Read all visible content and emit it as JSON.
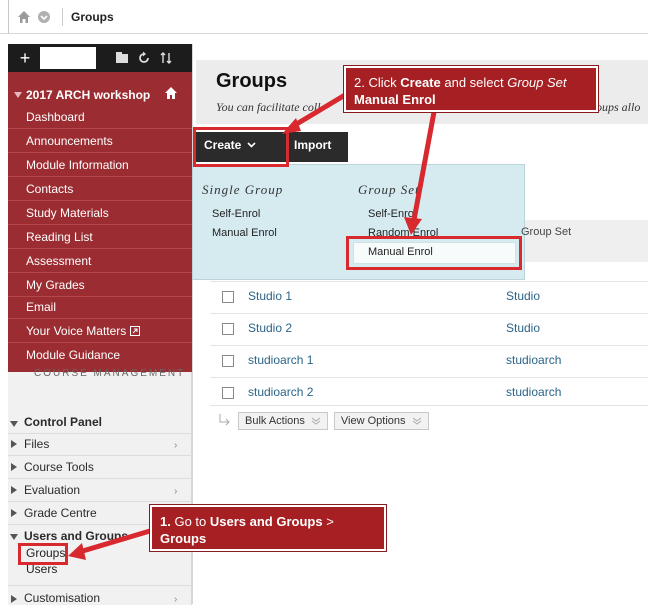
{
  "breadcrumb": {
    "current": "Groups"
  },
  "course": {
    "title": "2017 ARCH workshop",
    "menu": [
      "Dashboard",
      "Announcements",
      "Module Information",
      "Contacts",
      "Study Materials",
      "Reading List",
      "Assessment",
      "My Grades",
      "Email",
      "Your Voice Matters",
      "Module Guidance"
    ]
  },
  "management": {
    "heading": "COURSE MANAGEMENT",
    "control_panel": "Control Panel",
    "items": [
      "Files",
      "Course Tools",
      "Evaluation",
      "Grade Centre"
    ],
    "users_groups": "Users and Groups",
    "sub_items": [
      "Groups",
      "Users"
    ],
    "customisation": "Customisation"
  },
  "page": {
    "title": "Groups",
    "description_left": "You can facilitate coll",
    "description_right": "oups allo"
  },
  "toolbar": {
    "create": "Create",
    "import": "Import"
  },
  "dropdown": {
    "single_heading": "Single Group",
    "single_items": [
      "Self-Enrol",
      "Manual Enrol"
    ],
    "set_heading": "Group Set",
    "set_items": [
      "Self-Enrol",
      "Random Enrol",
      "Manual Enrol"
    ]
  },
  "table": {
    "column_set": "Group Set",
    "rows": [
      {
        "name": "Studio 1",
        "set": "Studio"
      },
      {
        "name": "Studio 2",
        "set": "Studio"
      },
      {
        "name": "studioarch 1",
        "set": "studioarch"
      },
      {
        "name": "studioarch 2",
        "set": "studioarch"
      }
    ],
    "bulk_actions": "Bulk Actions",
    "view_options": "View Options"
  },
  "annotations": {
    "step1_num": "1.",
    "step1_pre": "Go to",
    "step1_bold": "Users and Groups",
    "step1_sep": ">",
    "step1_bold2": "Groups",
    "step2_num": "2.",
    "step2_pre": "Click",
    "step2_bold": "Create",
    "step2_mid": "and select",
    "step2_italic": "Group Set",
    "step2_bold2": "Manual Enrol"
  },
  "colors": {
    "menu_red": "#9b2d32",
    "dropdown_bg": "#d6ebf0",
    "annotation_red": "#a51f23",
    "highlight": "#d8292f",
    "link": "#2a6488"
  }
}
